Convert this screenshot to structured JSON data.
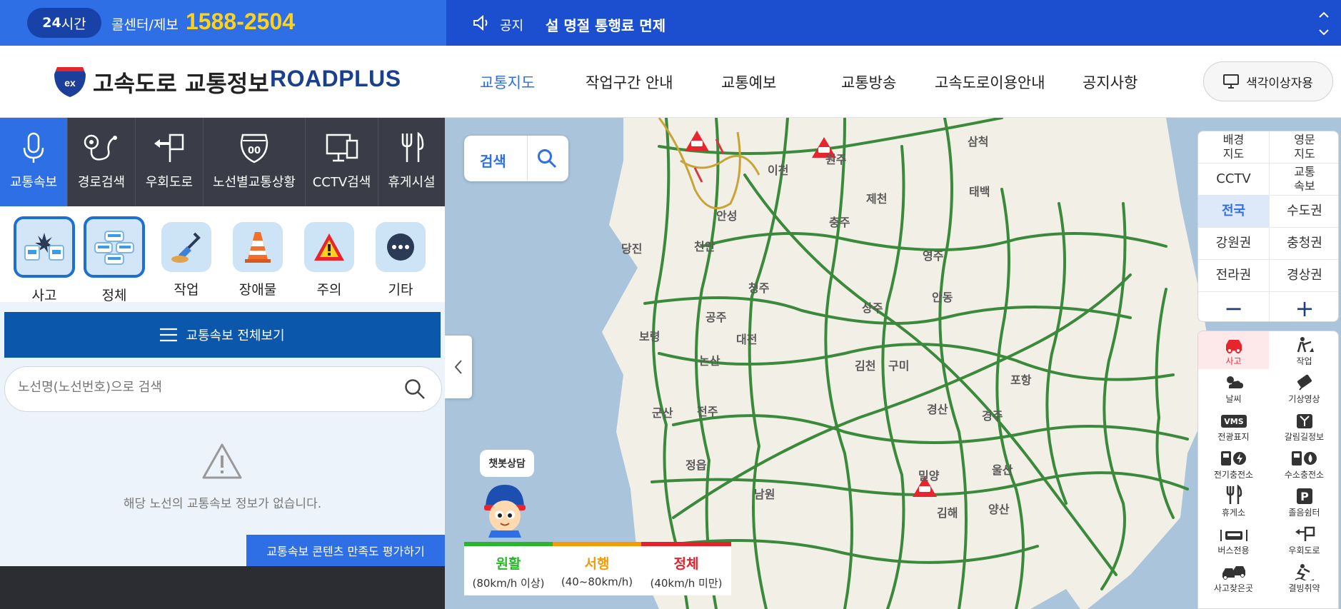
{
  "topbar": {
    "badge_num": "24",
    "badge_text": "시간",
    "callcenter": "콜센터/제보",
    "phone": "1588-2504",
    "notice_label": "공지",
    "notice_text": "설 명절 통행료 면제"
  },
  "header": {
    "logo_kr": "고속도로 교통정보",
    "logo_en": "ROADPLUS",
    "logo_badge": "ex",
    "nav": [
      "교통지도",
      "작업구간 안내",
      "교통예보",
      "교통방송",
      "고속도로이용안내",
      "공지사항"
    ],
    "color_vision_button": "색각이상자용"
  },
  "left": {
    "tabs": [
      "교통속보",
      "경로검색",
      "우회도로",
      "노선별교통상황",
      "CCTV검색",
      "휴게시설"
    ],
    "route_badge": "00",
    "categories": [
      "사고",
      "정체",
      "작업",
      "장애물",
      "주의",
      "기타"
    ],
    "all_button": "교통속보 전체보기",
    "search_placeholder": "노선명(노선번호)으로 검색",
    "empty_message": "해당 노선의 교통속보 정보가 없습니다.",
    "rate_button": "교통속보 콘텐츠 만족도 평가하기"
  },
  "map": {
    "search_label": "검색",
    "chatbot": "챗봇상담",
    "labels": [
      "삼척",
      "태백",
      "원주",
      "이천",
      "제천",
      "충주",
      "안성",
      "당진",
      "천안",
      "영주",
      "안동",
      "청주",
      "상주",
      "공주",
      "보령",
      "대전",
      "논산",
      "김천",
      "구미",
      "포항",
      "군산",
      "전주",
      "경주",
      "정읍",
      "경산",
      "울산",
      "밀양",
      "남원",
      "김해",
      "양산"
    ],
    "legend": [
      {
        "name": "원활",
        "range": "(80km/h 이상)",
        "color": "#2bb52b"
      },
      {
        "name": "서행",
        "range": "(40~80km/h)",
        "color": "#f59a00"
      },
      {
        "name": "정체",
        "range": "(40km/h 미만)",
        "color": "#e8202a"
      }
    ]
  },
  "right": {
    "layers": [
      "배경\n지도",
      "영문\n지도",
      "CCTV",
      "교통\n속보",
      "전국",
      "수도권",
      "강원권",
      "충청권",
      "전라권",
      "경상권"
    ],
    "zoom_out": "−",
    "zoom_in": "+",
    "icon_vms": "VMS",
    "icon_p": "P",
    "icons": [
      "사고",
      "작업",
      "날씨",
      "기상영상",
      "전광표지",
      "갈림길정보",
      "전기충전소",
      "수소충전소",
      "휴게소",
      "졸음쉼터",
      "버스전용",
      "우회도로",
      "사고잦은곳",
      "결빙취약"
    ]
  }
}
